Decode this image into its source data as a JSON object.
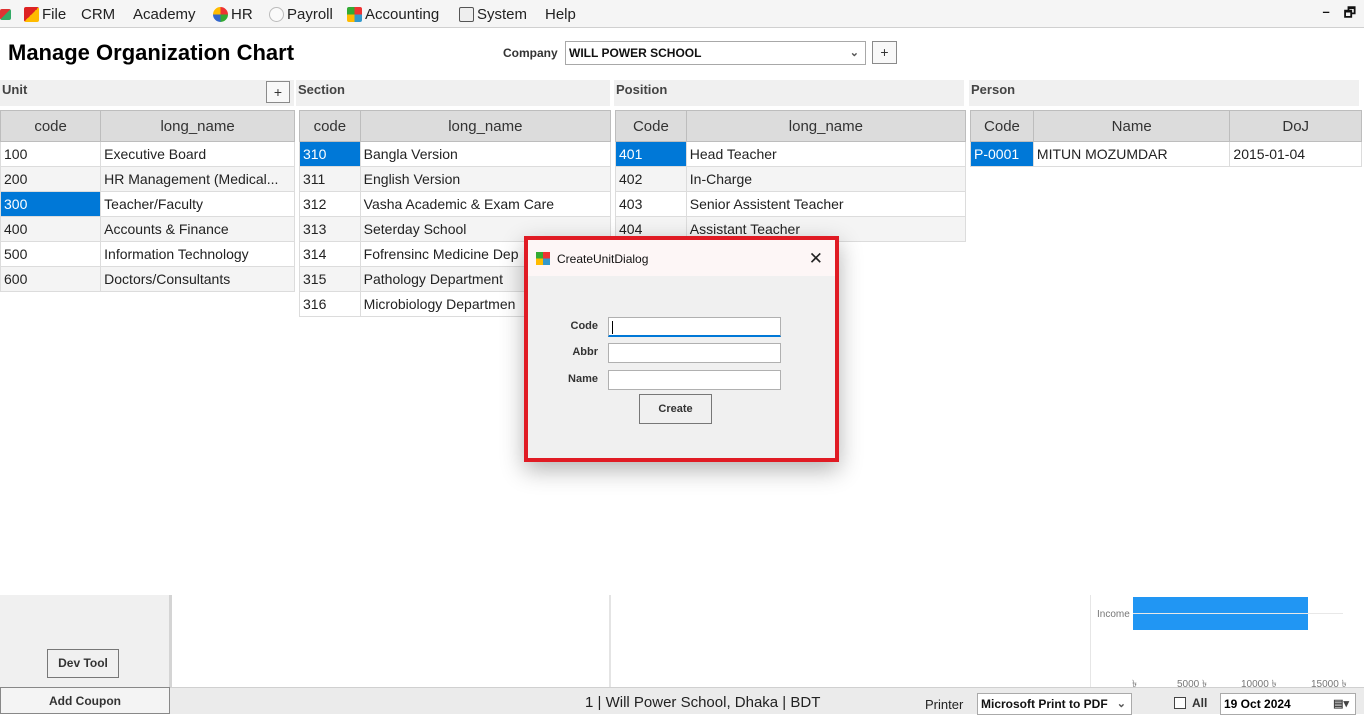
{
  "menu": {
    "items": [
      {
        "label": "File",
        "icon": "app-icon"
      },
      {
        "label": "CRM",
        "icon": ""
      },
      {
        "label": "Academy",
        "icon": ""
      },
      {
        "label": "HR",
        "icon": "hr-icon"
      },
      {
        "label": "Payroll",
        "icon": "payroll-icon"
      },
      {
        "label": "Accounting",
        "icon": "accounting-icon"
      },
      {
        "label": "System",
        "icon": "system-icon"
      },
      {
        "label": "Help",
        "icon": ""
      }
    ],
    "window_buttons": {
      "minimize": "–",
      "restore": "🗗"
    }
  },
  "page": {
    "title": "Manage Organization Chart",
    "company_label": "Company",
    "company_value": "WILL POWER SCHOOL",
    "add_symbol": "+"
  },
  "unit": {
    "header": "Unit",
    "columns": [
      "code",
      "long_name"
    ],
    "rows": [
      [
        "100",
        "Executive Board"
      ],
      [
        "200",
        "HR Management (Medical..."
      ],
      [
        "300",
        "Teacher/Faculty"
      ],
      [
        "400",
        "Accounts & Finance"
      ],
      [
        "500",
        "Information Technology"
      ],
      [
        "600",
        "Doctors/Consultants"
      ]
    ],
    "selected_index": 2
  },
  "section": {
    "header": "Section",
    "columns": [
      "code",
      "long_name"
    ],
    "rows": [
      [
        "310",
        "Bangla Version"
      ],
      [
        "311",
        "English Version"
      ],
      [
        "312",
        "Vasha Academic & Exam Care"
      ],
      [
        "313",
        "Seterday School"
      ],
      [
        "314",
        "Fofrensinc Medicine Dep"
      ],
      [
        "315",
        "Pathology Department"
      ],
      [
        "316",
        "Microbiology Departmen"
      ]
    ],
    "selected_index": 0
  },
  "position": {
    "header": "Position",
    "columns": [
      "Code",
      "long_name"
    ],
    "rows": [
      [
        "401",
        "Head Teacher"
      ],
      [
        "402",
        "In-Charge"
      ],
      [
        "403",
        "Senior Assistent Teacher"
      ],
      [
        "404",
        "Assistant Teacher"
      ]
    ],
    "selected_index": 0
  },
  "person": {
    "header": "Person",
    "columns": [
      "Code",
      "Name",
      "DoJ"
    ],
    "rows": [
      [
        "P-0001",
        "MITUN MOZUMDAR",
        "2015-01-04"
      ]
    ],
    "selected_index": 0
  },
  "dialog": {
    "title": "CreateUnitDialog",
    "close_symbol": "✕",
    "fields": [
      {
        "label": "Code",
        "value": ""
      },
      {
        "label": "Abbr",
        "value": ""
      },
      {
        "label": "Name",
        "value": ""
      }
    ],
    "create_button": "Create"
  },
  "bottom": {
    "dev_tool": "Dev Tool",
    "add_coupon": "Add Coupon",
    "status_text": "1 | Will Power School, Dhaka | BDT",
    "printer_label": "Printer",
    "printer_value": "Microsoft Print to PDF",
    "all_label": "All",
    "date_value": "19  Oct  2024"
  },
  "chart_data": {
    "type": "bar",
    "orientation": "horizontal",
    "categories": [
      "Income"
    ],
    "values": [
      12500
    ],
    "xlim": [
      0,
      15000
    ],
    "x_tick_labels": [
      "৳",
      "5000 ৳",
      "10000 ৳",
      "15000 ৳"
    ],
    "bar_color": "#2196f3"
  }
}
